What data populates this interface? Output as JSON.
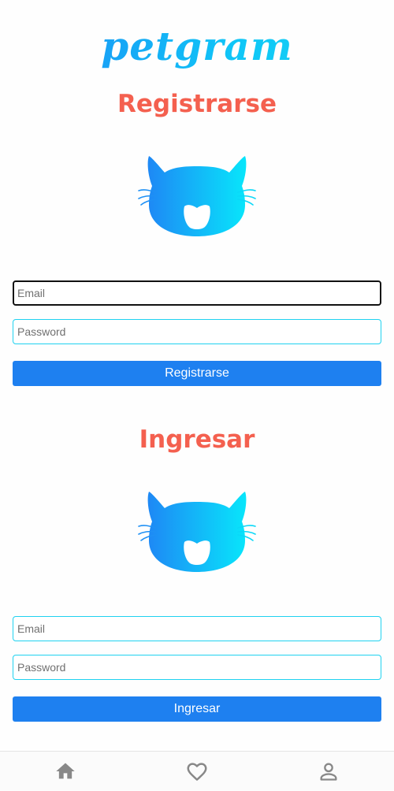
{
  "app": {
    "logo": "petgram"
  },
  "register": {
    "title": "Registrarse",
    "email_placeholder": "Email",
    "password_placeholder": "Password",
    "button_label": "Registrarse"
  },
  "login": {
    "title": "Ingresar",
    "email_placeholder": "Email",
    "password_placeholder": "Password",
    "button_label": "Ingresar"
  },
  "icons": {
    "cat": "cat-icon",
    "home": "home-icon",
    "favorites": "heart-icon",
    "user": "user-icon"
  },
  "colors": {
    "brand_blue": "#1e80f0",
    "brand_cyan": "#13d8f7",
    "title_red": "#f4604f",
    "nav_icon": "#888888"
  }
}
